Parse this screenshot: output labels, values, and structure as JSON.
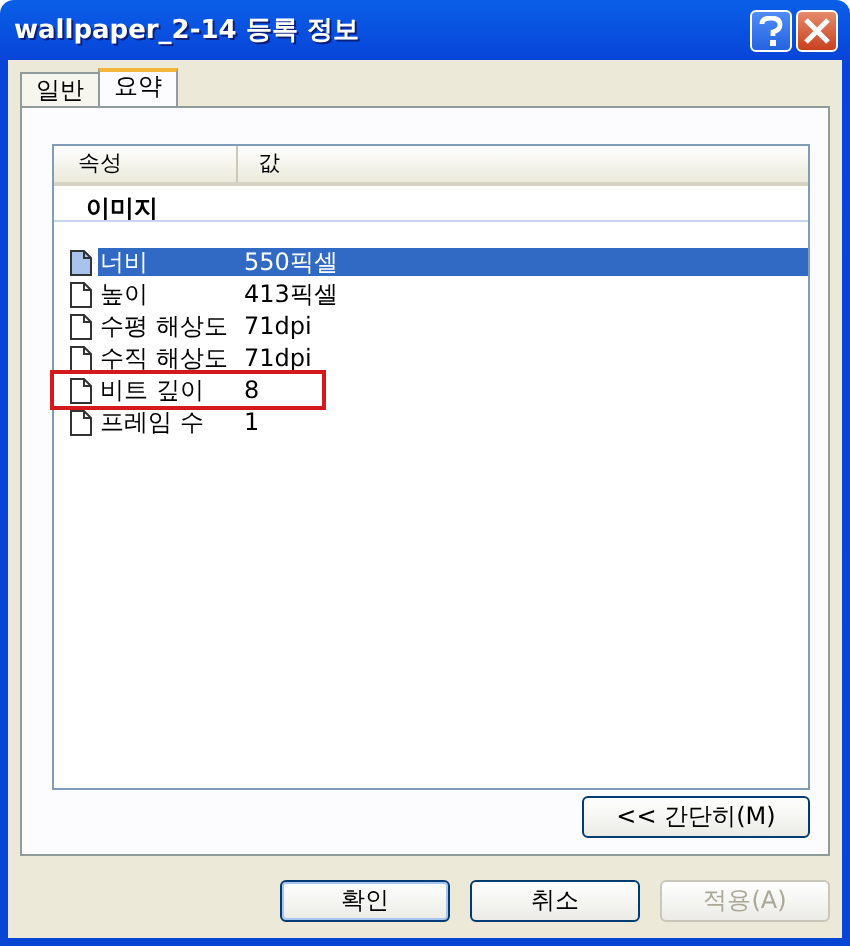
{
  "window": {
    "title": "wallpaper_2-14 등록 정보"
  },
  "tabs": [
    {
      "label": "일반",
      "selected": false
    },
    {
      "label": "요약",
      "selected": true
    }
  ],
  "table": {
    "columns": [
      "속성",
      "값"
    ],
    "group": "이미지",
    "rows": [
      {
        "name": "너비",
        "value": "550픽셀",
        "selected": true,
        "annotated": false
      },
      {
        "name": "높이",
        "value": "413픽셀",
        "selected": false,
        "annotated": false
      },
      {
        "name": "수평 해상도",
        "value": "71dpi",
        "selected": false,
        "annotated": false
      },
      {
        "name": "수직 해상도",
        "value": "71dpi",
        "selected": false,
        "annotated": false
      },
      {
        "name": "비트 깊이",
        "value": "8",
        "selected": false,
        "annotated": true
      },
      {
        "name": "프레임 수",
        "value": "1",
        "selected": false,
        "annotated": false
      }
    ]
  },
  "simple_button": "<< 간단히(M)",
  "buttons": [
    {
      "label": "확인",
      "disabled": false,
      "default": true
    },
    {
      "label": "취소",
      "disabled": false,
      "default": false
    },
    {
      "label": "적용(A)",
      "disabled": true,
      "default": false
    }
  ]
}
